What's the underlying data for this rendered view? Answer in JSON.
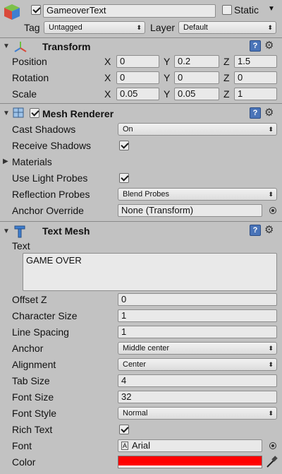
{
  "header": {
    "object_name": "GameoverText",
    "static_label": "Static",
    "tag_label": "Tag",
    "tag_value": "Untagged",
    "layer_label": "Layer",
    "layer_value": "Default"
  },
  "transform": {
    "title": "Transform",
    "rows": [
      {
        "label": "Position",
        "x": "0",
        "y": "0.2",
        "z": "1.5"
      },
      {
        "label": "Rotation",
        "x": "0",
        "y": "0",
        "z": "0"
      },
      {
        "label": "Scale",
        "x": "0.05",
        "y": "0.05",
        "z": "1"
      }
    ],
    "axis_x": "X",
    "axis_y": "Y",
    "axis_z": "Z"
  },
  "mesh_renderer": {
    "title": "Mesh Renderer",
    "cast_shadows_label": "Cast Shadows",
    "cast_shadows_value": "On",
    "receive_shadows_label": "Receive Shadows",
    "materials_label": "Materials",
    "use_light_probes_label": "Use Light Probes",
    "reflection_probes_label": "Reflection Probes",
    "reflection_probes_value": "Blend Probes",
    "anchor_override_label": "Anchor Override",
    "anchor_override_value": "None (Transform)"
  },
  "text_mesh": {
    "title": "Text Mesh",
    "text_label": "Text",
    "text_value": "GAME OVER",
    "offset_z_label": "Offset Z",
    "offset_z_value": "0",
    "character_size_label": "Character Size",
    "character_size_value": "1",
    "line_spacing_label": "Line Spacing",
    "line_spacing_value": "1",
    "anchor_label": "Anchor",
    "anchor_value": "Middle center",
    "alignment_label": "Alignment",
    "alignment_value": "Center",
    "tab_size_label": "Tab Size",
    "tab_size_value": "4",
    "font_size_label": "Font Size",
    "font_size_value": "32",
    "font_style_label": "Font Style",
    "font_style_value": "Normal",
    "rich_text_label": "Rich Text",
    "font_label": "Font",
    "font_value": "Arial",
    "color_label": "Color",
    "color_value": "#ff0000"
  },
  "icons": {
    "help": "?",
    "gear": "⚙",
    "dropdown_arrow": "⬍"
  }
}
